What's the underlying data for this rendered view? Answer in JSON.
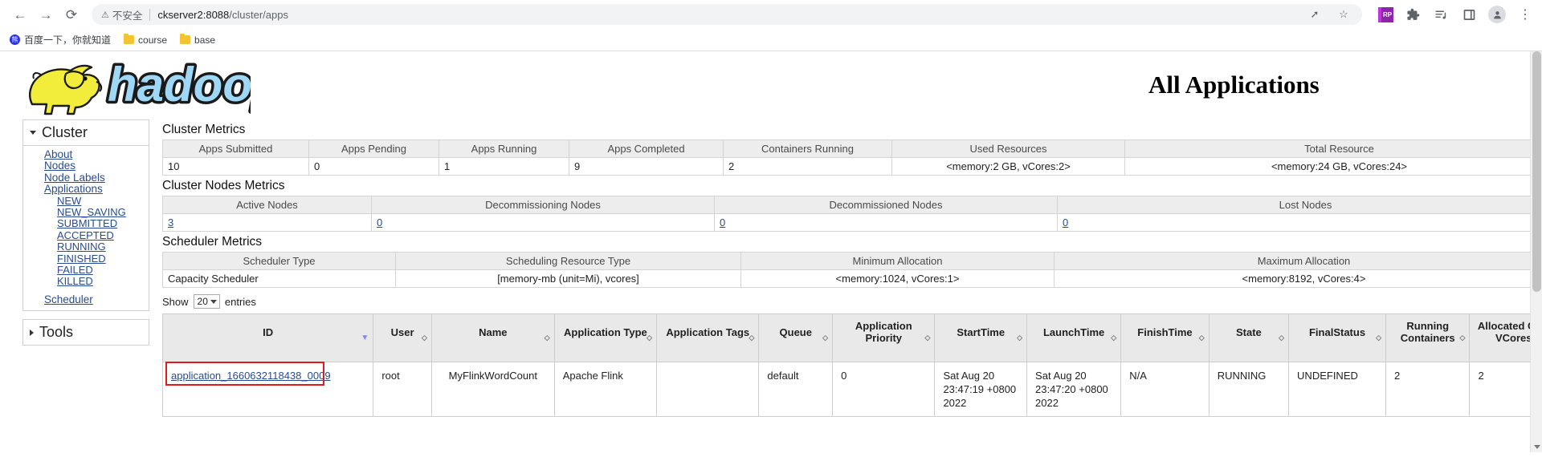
{
  "browser": {
    "back_icon": "back-arrow-icon",
    "forward_icon": "forward-arrow-icon",
    "reload_icon": "reload-icon",
    "security_warning": "不安全",
    "url_host": "ckserver2:8088",
    "url_path": "/cluster/apps",
    "share_icon": "share-icon",
    "star_icon": "star-icon",
    "extension_rp_label": "RP",
    "extensions_icon": "puzzle-piece-icon",
    "reading_list_icon": "reading-list-icon",
    "side_panel_icon": "side-panel-icon",
    "profile_icon": "profile-avatar-icon",
    "menu_icon": "three-dot-menu-icon",
    "bookmarks": [
      {
        "label": "百度一下，你就知道",
        "icon": "baidu-icon"
      },
      {
        "label": "course",
        "icon": "folder-icon"
      },
      {
        "label": "base",
        "icon": "folder-icon"
      }
    ]
  },
  "page": {
    "logo_alt": "hadoop",
    "title": "All Applications"
  },
  "sidebar": {
    "cluster": {
      "header": "Cluster",
      "links": [
        "About",
        "Nodes",
        "Node Labels",
        "Applications"
      ],
      "states": [
        "NEW",
        "NEW_SAVING",
        "SUBMITTED",
        "ACCEPTED",
        "RUNNING",
        "FINISHED",
        "FAILED",
        "KILLED"
      ],
      "scheduler": "Scheduler"
    },
    "tools": {
      "header": "Tools"
    }
  },
  "cluster_metrics": {
    "title": "Cluster Metrics",
    "headers": [
      "Apps Submitted",
      "Apps Pending",
      "Apps Running",
      "Apps Completed",
      "Containers Running",
      "Used Resources",
      "Total Resource"
    ],
    "values": [
      "10",
      "0",
      "1",
      "9",
      "2",
      "<memory:2 GB, vCores:2>",
      "<memory:24 GB, vCores:24>"
    ]
  },
  "cluster_nodes_metrics": {
    "title": "Cluster Nodes Metrics",
    "headers": [
      "Active Nodes",
      "Decommissioning Nodes",
      "Decommissioned Nodes",
      "Lost Nodes"
    ],
    "values": [
      "3",
      "0",
      "0",
      "0"
    ]
  },
  "scheduler_metrics": {
    "title": "Scheduler Metrics",
    "headers": [
      "Scheduler Type",
      "Scheduling Resource Type",
      "Minimum Allocation",
      "Maximum Allocation"
    ],
    "values": [
      "Capacity Scheduler",
      "[memory-mb (unit=Mi), vcores]",
      "<memory:1024, vCores:1>",
      "<memory:8192, vCores:4>"
    ]
  },
  "table_controls": {
    "show_label": "Show",
    "page_size": "20",
    "entries_label": "entries"
  },
  "apps_table": {
    "headers": [
      "ID",
      "User",
      "Name",
      "Application Type",
      "Application Tags",
      "Queue",
      "Application Priority",
      "StartTime",
      "LaunchTime",
      "FinishTime",
      "State",
      "FinalStatus",
      "Running Containers",
      "Allocated CPU VCores"
    ],
    "rows": [
      {
        "id": "application_1660632118438_0009",
        "user": "root",
        "name": "MyFlinkWordCount",
        "app_type": "Apache Flink",
        "app_tags": "",
        "queue": "default",
        "priority": "0",
        "start_time": "Sat Aug 20 23:47:19 +0800 2022",
        "launch_time": "Sat Aug 20 23:47:20 +0800 2022",
        "finish_time": "N/A",
        "state": "RUNNING",
        "final_status": "UNDEFINED",
        "running_containers": "2",
        "allocated_cpu_vcores": "2"
      }
    ]
  },
  "colors": {
    "highlight_border": "#e01b1b",
    "link": "#2a4b8d",
    "logo_blue": "#9fd7f7",
    "logo_yellow": "#f2ec3a",
    "sort_active": "#7b86ef"
  }
}
